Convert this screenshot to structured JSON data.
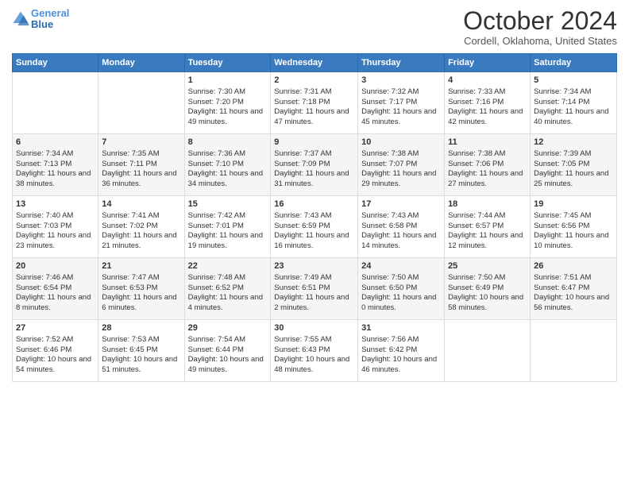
{
  "header": {
    "logo_line1": "General",
    "logo_line2": "Blue",
    "month": "October 2024",
    "location": "Cordell, Oklahoma, United States"
  },
  "days_of_week": [
    "Sunday",
    "Monday",
    "Tuesday",
    "Wednesday",
    "Thursday",
    "Friday",
    "Saturday"
  ],
  "weeks": [
    [
      {
        "day": "",
        "sunrise": "",
        "sunset": "",
        "daylight": ""
      },
      {
        "day": "",
        "sunrise": "",
        "sunset": "",
        "daylight": ""
      },
      {
        "day": "1",
        "sunrise": "Sunrise: 7:30 AM",
        "sunset": "Sunset: 7:20 PM",
        "daylight": "Daylight: 11 hours and 49 minutes."
      },
      {
        "day": "2",
        "sunrise": "Sunrise: 7:31 AM",
        "sunset": "Sunset: 7:18 PM",
        "daylight": "Daylight: 11 hours and 47 minutes."
      },
      {
        "day": "3",
        "sunrise": "Sunrise: 7:32 AM",
        "sunset": "Sunset: 7:17 PM",
        "daylight": "Daylight: 11 hours and 45 minutes."
      },
      {
        "day": "4",
        "sunrise": "Sunrise: 7:33 AM",
        "sunset": "Sunset: 7:16 PM",
        "daylight": "Daylight: 11 hours and 42 minutes."
      },
      {
        "day": "5",
        "sunrise": "Sunrise: 7:34 AM",
        "sunset": "Sunset: 7:14 PM",
        "daylight": "Daylight: 11 hours and 40 minutes."
      }
    ],
    [
      {
        "day": "6",
        "sunrise": "Sunrise: 7:34 AM",
        "sunset": "Sunset: 7:13 PM",
        "daylight": "Daylight: 11 hours and 38 minutes."
      },
      {
        "day": "7",
        "sunrise": "Sunrise: 7:35 AM",
        "sunset": "Sunset: 7:11 PM",
        "daylight": "Daylight: 11 hours and 36 minutes."
      },
      {
        "day": "8",
        "sunrise": "Sunrise: 7:36 AM",
        "sunset": "Sunset: 7:10 PM",
        "daylight": "Daylight: 11 hours and 34 minutes."
      },
      {
        "day": "9",
        "sunrise": "Sunrise: 7:37 AM",
        "sunset": "Sunset: 7:09 PM",
        "daylight": "Daylight: 11 hours and 31 minutes."
      },
      {
        "day": "10",
        "sunrise": "Sunrise: 7:38 AM",
        "sunset": "Sunset: 7:07 PM",
        "daylight": "Daylight: 11 hours and 29 minutes."
      },
      {
        "day": "11",
        "sunrise": "Sunrise: 7:38 AM",
        "sunset": "Sunset: 7:06 PM",
        "daylight": "Daylight: 11 hours and 27 minutes."
      },
      {
        "day": "12",
        "sunrise": "Sunrise: 7:39 AM",
        "sunset": "Sunset: 7:05 PM",
        "daylight": "Daylight: 11 hours and 25 minutes."
      }
    ],
    [
      {
        "day": "13",
        "sunrise": "Sunrise: 7:40 AM",
        "sunset": "Sunset: 7:03 PM",
        "daylight": "Daylight: 11 hours and 23 minutes."
      },
      {
        "day": "14",
        "sunrise": "Sunrise: 7:41 AM",
        "sunset": "Sunset: 7:02 PM",
        "daylight": "Daylight: 11 hours and 21 minutes."
      },
      {
        "day": "15",
        "sunrise": "Sunrise: 7:42 AM",
        "sunset": "Sunset: 7:01 PM",
        "daylight": "Daylight: 11 hours and 19 minutes."
      },
      {
        "day": "16",
        "sunrise": "Sunrise: 7:43 AM",
        "sunset": "Sunset: 6:59 PM",
        "daylight": "Daylight: 11 hours and 16 minutes."
      },
      {
        "day": "17",
        "sunrise": "Sunrise: 7:43 AM",
        "sunset": "Sunset: 6:58 PM",
        "daylight": "Daylight: 11 hours and 14 minutes."
      },
      {
        "day": "18",
        "sunrise": "Sunrise: 7:44 AM",
        "sunset": "Sunset: 6:57 PM",
        "daylight": "Daylight: 11 hours and 12 minutes."
      },
      {
        "day": "19",
        "sunrise": "Sunrise: 7:45 AM",
        "sunset": "Sunset: 6:56 PM",
        "daylight": "Daylight: 11 hours and 10 minutes."
      }
    ],
    [
      {
        "day": "20",
        "sunrise": "Sunrise: 7:46 AM",
        "sunset": "Sunset: 6:54 PM",
        "daylight": "Daylight: 11 hours and 8 minutes."
      },
      {
        "day": "21",
        "sunrise": "Sunrise: 7:47 AM",
        "sunset": "Sunset: 6:53 PM",
        "daylight": "Daylight: 11 hours and 6 minutes."
      },
      {
        "day": "22",
        "sunrise": "Sunrise: 7:48 AM",
        "sunset": "Sunset: 6:52 PM",
        "daylight": "Daylight: 11 hours and 4 minutes."
      },
      {
        "day": "23",
        "sunrise": "Sunrise: 7:49 AM",
        "sunset": "Sunset: 6:51 PM",
        "daylight": "Daylight: 11 hours and 2 minutes."
      },
      {
        "day": "24",
        "sunrise": "Sunrise: 7:50 AM",
        "sunset": "Sunset: 6:50 PM",
        "daylight": "Daylight: 11 hours and 0 minutes."
      },
      {
        "day": "25",
        "sunrise": "Sunrise: 7:50 AM",
        "sunset": "Sunset: 6:49 PM",
        "daylight": "Daylight: 10 hours and 58 minutes."
      },
      {
        "day": "26",
        "sunrise": "Sunrise: 7:51 AM",
        "sunset": "Sunset: 6:47 PM",
        "daylight": "Daylight: 10 hours and 56 minutes."
      }
    ],
    [
      {
        "day": "27",
        "sunrise": "Sunrise: 7:52 AM",
        "sunset": "Sunset: 6:46 PM",
        "daylight": "Daylight: 10 hours and 54 minutes."
      },
      {
        "day": "28",
        "sunrise": "Sunrise: 7:53 AM",
        "sunset": "Sunset: 6:45 PM",
        "daylight": "Daylight: 10 hours and 51 minutes."
      },
      {
        "day": "29",
        "sunrise": "Sunrise: 7:54 AM",
        "sunset": "Sunset: 6:44 PM",
        "daylight": "Daylight: 10 hours and 49 minutes."
      },
      {
        "day": "30",
        "sunrise": "Sunrise: 7:55 AM",
        "sunset": "Sunset: 6:43 PM",
        "daylight": "Daylight: 10 hours and 48 minutes."
      },
      {
        "day": "31",
        "sunrise": "Sunrise: 7:56 AM",
        "sunset": "Sunset: 6:42 PM",
        "daylight": "Daylight: 10 hours and 46 minutes."
      },
      {
        "day": "",
        "sunrise": "",
        "sunset": "",
        "daylight": ""
      },
      {
        "day": "",
        "sunrise": "",
        "sunset": "",
        "daylight": ""
      }
    ]
  ]
}
